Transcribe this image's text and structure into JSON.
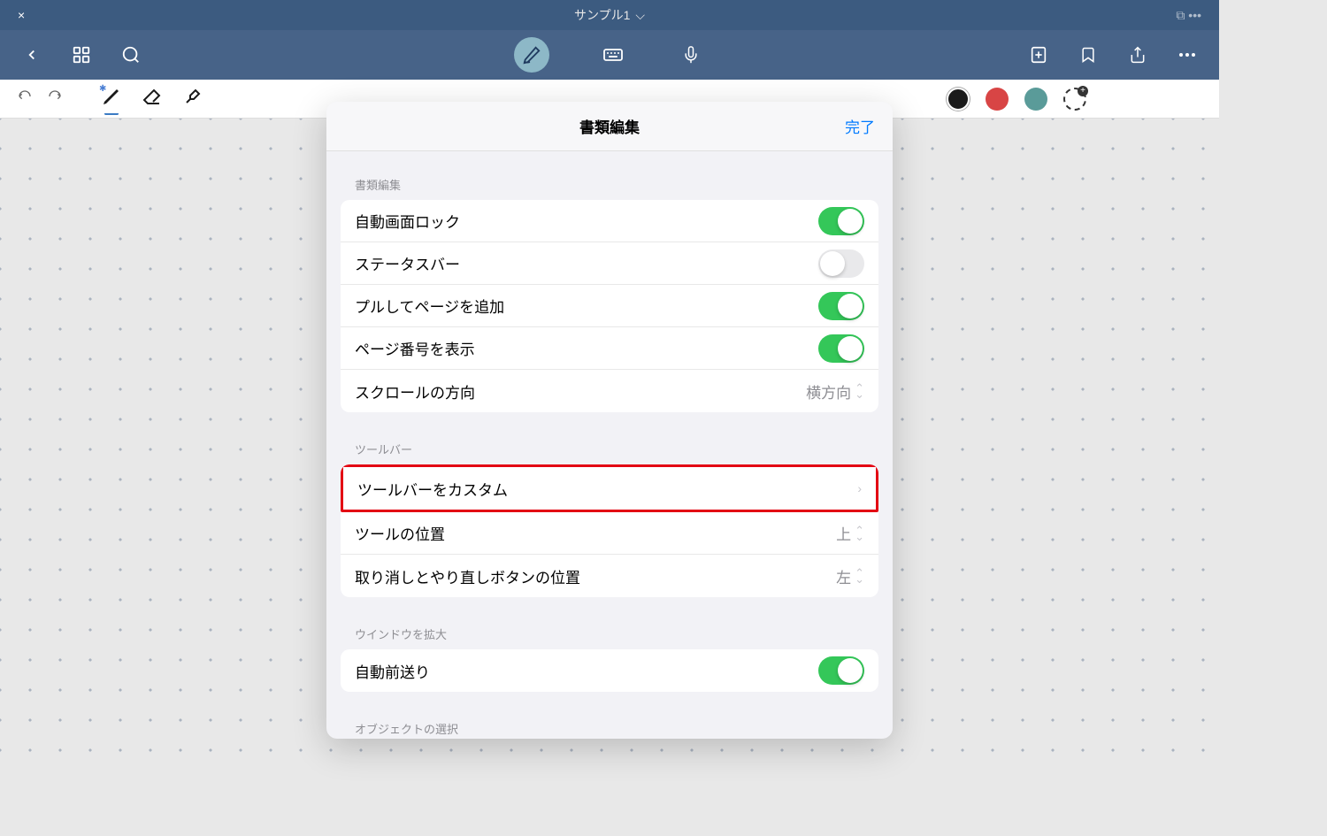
{
  "titleBar": {
    "docTitle": "サンプル1"
  },
  "modal": {
    "title": "書類編集",
    "done": "完了",
    "sections": {
      "docEdit": {
        "label": "書類編集",
        "autoScreenLock": {
          "label": "自動画面ロック",
          "on": true
        },
        "statusBar": {
          "label": "ステータスバー",
          "on": false
        },
        "pullToAdd": {
          "label": "プルしてページを追加",
          "on": true
        },
        "showPageNum": {
          "label": "ページ番号を表示",
          "on": true
        },
        "scrollDir": {
          "label": "スクロールの方向",
          "value": "横方向"
        }
      },
      "toolbar": {
        "label": "ツールバー",
        "customize": {
          "label": "ツールバーをカスタム"
        },
        "position": {
          "label": "ツールの位置",
          "value": "上"
        },
        "undoRedoPos": {
          "label": "取り消しとやり直しボタンの位置",
          "value": "左"
        }
      },
      "windowZoom": {
        "label": "ウインドウを拡大",
        "autoAdvance": {
          "label": "自動前送り",
          "on": true
        }
      },
      "objectSelect": {
        "label": "オブジェクトの選択"
      }
    }
  },
  "colors": {
    "black": "#1a1a1a",
    "red": "#d84545",
    "teal": "#5a9b99"
  }
}
